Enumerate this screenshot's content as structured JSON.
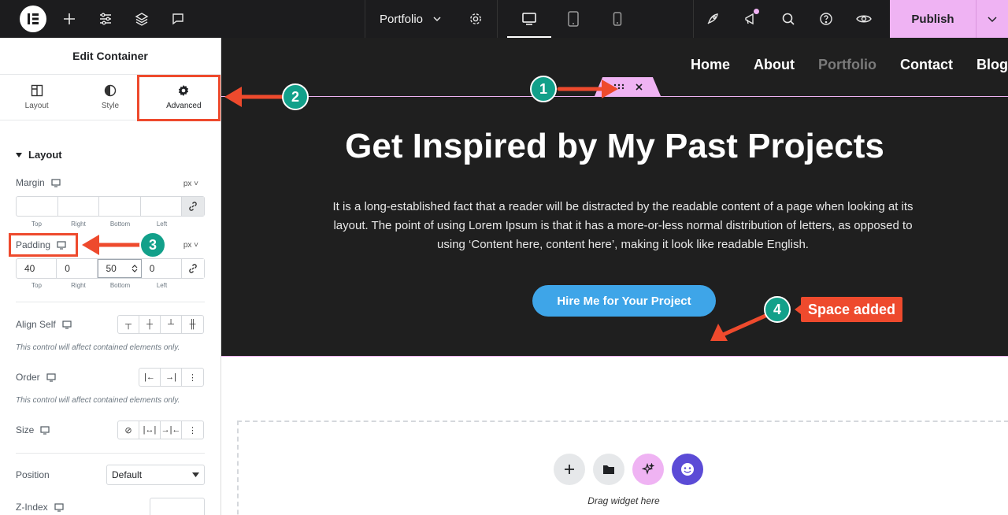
{
  "topbar": {
    "document_name": "Portfolio",
    "publish_label": "Publish",
    "icons": [
      "elementor-logo-icon",
      "add-icon",
      "settings-sliders-icon",
      "layers-icon",
      "comments-icon",
      "chevron-down-icon",
      "gear-icon",
      "desktop-icon",
      "tablet-icon",
      "mobile-icon",
      "rocket-icon",
      "announcement-icon",
      "search-icon",
      "help-icon",
      "preview-eye-icon"
    ],
    "publish_color": "#efb3f3"
  },
  "panel": {
    "title": "Edit Container",
    "tabs": [
      {
        "label": "Layout"
      },
      {
        "label": "Style"
      },
      {
        "label": "Advanced"
      }
    ],
    "section": "Layout",
    "margin": {
      "label": "Margin",
      "unit": "px",
      "values": [
        "",
        "",
        "",
        ""
      ],
      "sub_labels": [
        "Top",
        "Right",
        "Bottom",
        "Left"
      ]
    },
    "padding": {
      "label": "Padding",
      "unit": "px",
      "values": [
        "40",
        "0",
        "50",
        "0"
      ],
      "sub_labels": [
        "Top",
        "Right",
        "Bottom",
        "Left"
      ]
    },
    "align_self": {
      "label": "Align Self",
      "note": "This control will affect contained elements only."
    },
    "order": {
      "label": "Order",
      "note": "This control will affect contained elements only."
    },
    "size": {
      "label": "Size"
    },
    "position": {
      "label": "Position",
      "value": "Default"
    },
    "z_index": {
      "label": "Z-Index"
    }
  },
  "canvas": {
    "nav": [
      "Home",
      "About",
      "Portfolio",
      "Contact",
      "Blog"
    ],
    "hero_title": "Get Inspired by My Past Projects",
    "hero_text": "It is a long-established fact that a reader will be distracted by the readable content of a page when looking at its layout. The point of using Lorem Ipsum is that it has a more-or-less normal distribution of letters, as opposed to using ‘Content here, content here’, making it look like readable English.",
    "cta_label": "Hire Me for Your Project",
    "dropzone_label": "Drag widget here",
    "accent_button": "#3ea5e8"
  },
  "annotations": {
    "badges": [
      "1",
      "2",
      "3",
      "4"
    ],
    "space_label": "Space added",
    "color": "#ee4a2d",
    "badge_color": "#12a08a"
  }
}
